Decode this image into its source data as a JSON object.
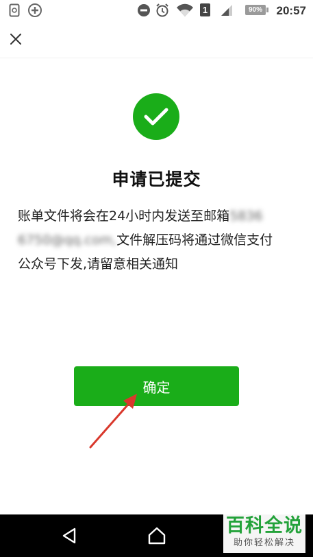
{
  "status_bar": {
    "time": "20:57",
    "battery": "90%",
    "sim": "1",
    "icons": [
      "phone-storage-icon",
      "add-circle-icon",
      "do-not-disturb-icon",
      "alarm-icon",
      "wifi-icon",
      "sim-icon",
      "signal-icon",
      "battery-icon"
    ]
  },
  "header": {
    "close_icon": "close-icon"
  },
  "result": {
    "icon": "check-circle-icon",
    "icon_color": "#1aad19",
    "title": "申请已提交",
    "message_line1": "账单文件将会在24小时内发送至邮箱",
    "email_part1": "5836",
    "email_part2": "6750@qq.com,",
    "message_line2_rest": "文件解压码将通过微信支付",
    "message_line3": "公众号下发,请留意相关通知"
  },
  "actions": {
    "confirm_label": "确定",
    "confirm_color": "#1aad19"
  },
  "annotation": {
    "arrow_color": "#d9382c"
  },
  "nav_bar": {
    "back_icon": "back-triangle-icon",
    "home_icon": "home-icon"
  },
  "watermark": {
    "main": "百科全说",
    "sub": "助你轻松解决"
  }
}
